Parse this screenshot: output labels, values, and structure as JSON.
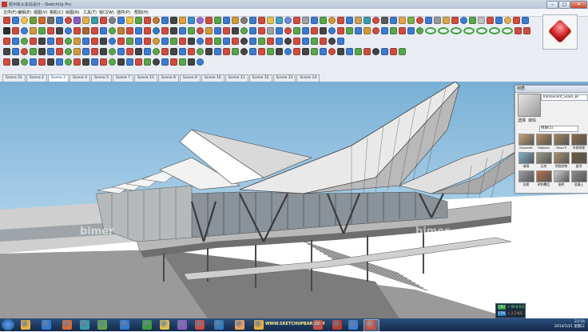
{
  "window": {
    "title": "杭州东火车站设计 - SketchUp Pro"
  },
  "menubar": {
    "items": [
      "文件(F)",
      "编辑(E)",
      "视图(V)",
      "相机(C)",
      "绘图(R)",
      "工具(T)",
      "窗口(W)",
      "插件(P)",
      "帮助(H)"
    ]
  },
  "toolbar_colors": {
    "row1": [
      "#d14c3f",
      "#3d7bd1",
      "#eec34a",
      "#6f9f3c",
      "#d06a2c",
      "#6d6d6d",
      "#3d7bd1",
      "#d14c3f",
      "#8a5fc0",
      "#e2b04a",
      "#3a9ea8",
      "#d14c3f",
      "#7e7e7e",
      "#3d7bd1",
      "#f0c040",
      "#5aa64b",
      "#d14c3f",
      "#c47a35",
      "#3d7bd1",
      "#444444",
      "#e0a23a",
      "#3c8fce",
      "#9a6ad6",
      "#d14c3f",
      "#5aa64b",
      "#3d7bd1",
      "#d19a3a",
      "#7c7c7c",
      "#3d7bd1",
      "#d14c3f",
      "#e2c24f",
      "#4aa1c4",
      "#6c8bd9",
      "#d14c3f",
      "#a0a0a0",
      "#3d7bd1",
      "#5aa64b",
      "#d19a3a",
      "#d14c3f",
      "#3d7bd1",
      "#c7a15a",
      "#3a9ea8",
      "#d14c3f",
      "#5a5a5a",
      "#3d7bd1",
      "#e9a24a",
      "#7fb04a",
      "#d14c3f",
      "#3d7bd1",
      "#9a9a9a",
      "#d9a74a",
      "#d14c3f",
      "#3d7bd1",
      "#5aa64b",
      "#c0c0c0",
      "#d14c3f",
      "#3d7bd1",
      "#e0b050",
      "#d14c3f",
      "#3d7bd1",
      "#6a6a6a",
      "#d14c3f",
      "#3d7bd1",
      "#5aa64b",
      "#d19a3a",
      "#d14c3f"
    ],
    "row2": [
      "#2e2e2e",
      "#d14c3f",
      "#3d7bd1",
      "#d19a3a",
      "#5aa64b",
      "#d14c3f",
      "#444444",
      "#3d7bd1",
      "#d14c3f",
      "#a7682f",
      "#d14c3f",
      "#3d7bd1",
      "#5aa64b",
      "#c47a35",
      "#d14c3f",
      "#3d7bd1",
      "#d14c3f",
      "#2e7dbd",
      "#d14c3f",
      "#444444",
      "#3d7bd1",
      "#5aa64b",
      "#d14c3f",
      "#d19a3a",
      "#3d7bd1",
      "#d14c3f",
      "#444444",
      "#5aa64b",
      "#3d7bd1",
      "#d14c3f",
      "#a0a0a0",
      "#3d7bd1",
      "#d14c3f",
      "#5aa64b",
      "#3d7bd1",
      "#d14c3f",
      "#444444",
      "#3d7bd1",
      "#d14c3f",
      "#5aa64b",
      "#3d7bd1",
      "#d19a3a",
      "#d14c3f",
      "#3d7bd1",
      "#5aa64b",
      "#d14c3f",
      "#3d7bd1",
      "#5aa64b",
      "#3aa13a",
      "#3aa13a",
      "#3aa13a",
      "#3aa13a",
      "#3aa13a",
      "#3aa13a",
      "#3aa13a",
      "#d14c3f",
      "#d14c3f"
    ],
    "row3": [
      "#d14c3f",
      "#3d7bd1",
      "#5aa64b",
      "#d14c3f",
      "#444444",
      "#3d7bd1",
      "#d14c3f",
      "#5aa64b",
      "#d19a3a",
      "#3d7bd1",
      "#d14c3f",
      "#444444",
      "#3d7bd1",
      "#d14c3f",
      "#5aa64b",
      "#3d7bd1",
      "#d14c3f",
      "#d19a3a",
      "#3d7bd1",
      "#5aa64b",
      "#d14c3f",
      "#444444",
      "#3d7bd1",
      "#d14c3f",
      "#5aa64b",
      "#3d7bd1",
      "#d14c3f",
      "#444444",
      "#3d7bd1",
      "#5aa64b",
      "#d14c3f",
      "#3d7bd1",
      "#444444",
      "#d14c3f",
      "#3d7bd1",
      "#5aa64b",
      "#d14c3f",
      "#444444",
      "#3d7bd1",
      "#d14c3f",
      "#5aa64b",
      "#3d7bd1",
      "#d14c3f",
      "#444444",
      "#3d7bd1",
      "#d14c3f",
      "#5aa64b",
      "#3d7bd1",
      "#d14c3f",
      "#444444",
      "#3d7bd1",
      "#5aa64b",
      "#d14c3f",
      "#3d7bd1",
      "#d14c3f",
      "#444444",
      "#3d7bd1",
      "#5aa64b",
      "#d14c3f"
    ],
    "row4": [
      "#444444",
      "#3d7bd1",
      "#d14c3f",
      "#5aa64b",
      "#444444",
      "#3d7bd1",
      "#d14c3f",
      "#5aa64b",
      "#d19a3a",
      "#3d7bd1",
      "#d14c3f",
      "#444444",
      "#5aa64b",
      "#3d7bd1",
      "#d14c3f",
      "#444444",
      "#3d7bd1",
      "#5aa64b",
      "#d14c3f",
      "#444444",
      "#3d7bd1",
      "#d14c3f",
      "#5aa64b",
      "#444444",
      "#3d7bd1",
      "#d14c3f",
      "#5aa64b",
      "#444444",
      "#3d7bd1",
      "#d14c3f",
      "#5aa64b",
      "#444444",
      "#3d7bd1",
      "#d14c3f",
      "#444444",
      "#5aa64b",
      "#3d7bd1",
      "#d14c3f",
      "#444444",
      "#3d7bd1",
      "#5aa64b",
      "#d14c3f",
      "#444444",
      "#3d7bd1",
      "#d14c3f",
      "#5aa64b",
      "#444444",
      "#3d7bd1",
      "#d14c3f",
      "#444444",
      "#3d7bd1",
      "#5aa64b",
      "#d14c3f",
      "#444444",
      "#3d7bd1",
      "#5aa64b",
      "#d14c3f",
      "#444444",
      "#3d7bd1",
      "#5aa64b",
      "#d14c3f",
      "#444444",
      "#3d7bd1"
    ]
  },
  "scene_tabs": {
    "items": [
      "Scene 31",
      "Scene 2",
      "Scene 3",
      "Scene 4",
      "Scene 5",
      "Scene 7",
      "Scene 15",
      "Scene 8",
      "Scene 9",
      "Scene 10",
      "Scene 11",
      "Scene 12",
      "Scene 13",
      "Scene 14"
    ],
    "active_index": 2
  },
  "viewport": {
    "watermark": "bimer",
    "sky_top": "#7fb4d8",
    "ground": "#ffffff"
  },
  "materials": {
    "title": "材质",
    "material_name": "Translucent_Glass_Bl",
    "tab_select": "选择",
    "tab_edit": "编辑",
    "dropdown_value": "材质(1)",
    "items": [
      "Geometr",
      "Materia",
      "Tonal P",
      "木质纹理",
      "玻璃",
      "石材",
      "地毯织物",
      "屋顶",
      "金属",
      "砖和覆层",
      "瓷砖",
      "混凝土"
    ]
  },
  "taskbar": {
    "site_label": "WWW.SKETCHUPBAR.COM",
    "icons": [
      "#f0b23a",
      "#2d7ad6",
      "#e06a2c",
      "#3a9ea8",
      "#5aa64b",
      "#2d7ad6",
      "#3aa13a",
      "#e0c34a",
      "#8a5fc0",
      "#d14c3f",
      "#2e7dbd",
      "#f0a35b",
      "#f0b23a",
      "#d14c3f",
      "#c0392b",
      "#3d7bd1",
      "#d14c3f"
    ],
    "time": "23:16",
    "date": "2014/5/21 星期三"
  },
  "net_widget": {
    "cpu_label": "CPU",
    "mem_label": "17%",
    "up": "↑ 69.8 K/S",
    "down": "↓ 2.2 K/S"
  }
}
